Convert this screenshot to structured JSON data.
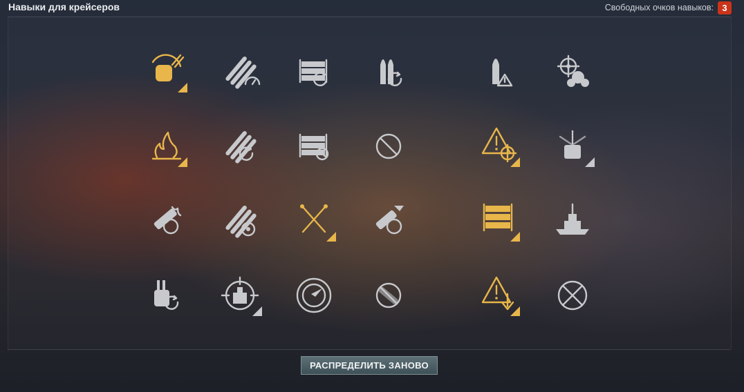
{
  "header": {
    "title": "Навыки для крейсеров",
    "free_points_label": "Свободных очков навыков:",
    "free_points_value": "3"
  },
  "colors": {
    "available": "#e8b64a",
    "locked": "#c7c9cc",
    "badge": "#c9341a"
  },
  "skills": [
    {
      "row": 0,
      "col": 0,
      "icon": "turret-rotation-icon",
      "state": "available",
      "corner": true
    },
    {
      "row": 0,
      "col": 1,
      "icon": "torpedo-speed-icon",
      "state": "locked",
      "corner": false
    },
    {
      "row": 0,
      "col": 2,
      "icon": "consumable-reload-icon",
      "state": "locked",
      "corner": false
    },
    {
      "row": 0,
      "col": 3,
      "icon": "shell-reload-icon",
      "state": "locked",
      "corner": false
    },
    {
      "row": 0,
      "col": 4,
      "icon": "shell-warning-icon",
      "state": "locked",
      "corner": false
    },
    {
      "row": 0,
      "col": 5,
      "icon": "ship-helm-propeller-icon",
      "state": "locked",
      "corner": false
    },
    {
      "row": 1,
      "col": 0,
      "icon": "fire-icon",
      "state": "available",
      "corner": true
    },
    {
      "row": 1,
      "col": 1,
      "icon": "torpedo-reload-icon",
      "state": "locked",
      "corner": false
    },
    {
      "row": 1,
      "col": 2,
      "icon": "consumable-timer-icon",
      "state": "locked",
      "corner": false
    },
    {
      "row": 1,
      "col": 3,
      "icon": "blocked-icon",
      "state": "locked",
      "corner": false
    },
    {
      "row": 1,
      "col": 4,
      "icon": "alert-crosshair-icon",
      "state": "available",
      "corner": true
    },
    {
      "row": 1,
      "col": 5,
      "icon": "radar-ship-icon",
      "state": "locked",
      "corner": true
    },
    {
      "row": 2,
      "col": 0,
      "icon": "aa-fire-icon",
      "state": "locked",
      "corner": false
    },
    {
      "row": 2,
      "col": 1,
      "icon": "torpedo-armament-icon",
      "state": "locked",
      "corner": false
    },
    {
      "row": 2,
      "col": 2,
      "icon": "crossed-wrenches-icon",
      "state": "available",
      "corner": true
    },
    {
      "row": 2,
      "col": 3,
      "icon": "aa-flag-icon",
      "state": "locked",
      "corner": false
    },
    {
      "row": 2,
      "col": 4,
      "icon": "consumable-stack-icon",
      "state": "available",
      "corner": true
    },
    {
      "row": 2,
      "col": 5,
      "icon": "battleship-icon",
      "state": "locked",
      "corner": false
    },
    {
      "row": 3,
      "col": 0,
      "icon": "main-battery-reload-icon",
      "state": "locked",
      "corner": false
    },
    {
      "row": 3,
      "col": 1,
      "icon": "target-ship-icon",
      "state": "locked",
      "corner": true
    },
    {
      "row": 3,
      "col": 2,
      "icon": "radar-compass-icon",
      "state": "locked",
      "corner": false
    },
    {
      "row": 3,
      "col": 3,
      "icon": "blocked-aa-icon",
      "state": "locked",
      "corner": false
    },
    {
      "row": 3,
      "col": 4,
      "icon": "alert-down-icon",
      "state": "available",
      "corner": true
    },
    {
      "row": 3,
      "col": 5,
      "icon": "crossed-aa-guns-icon",
      "state": "locked",
      "corner": false
    }
  ],
  "footer": {
    "reset_button_label": "РАСПРЕДЕЛИТЬ ЗАНОВО"
  }
}
